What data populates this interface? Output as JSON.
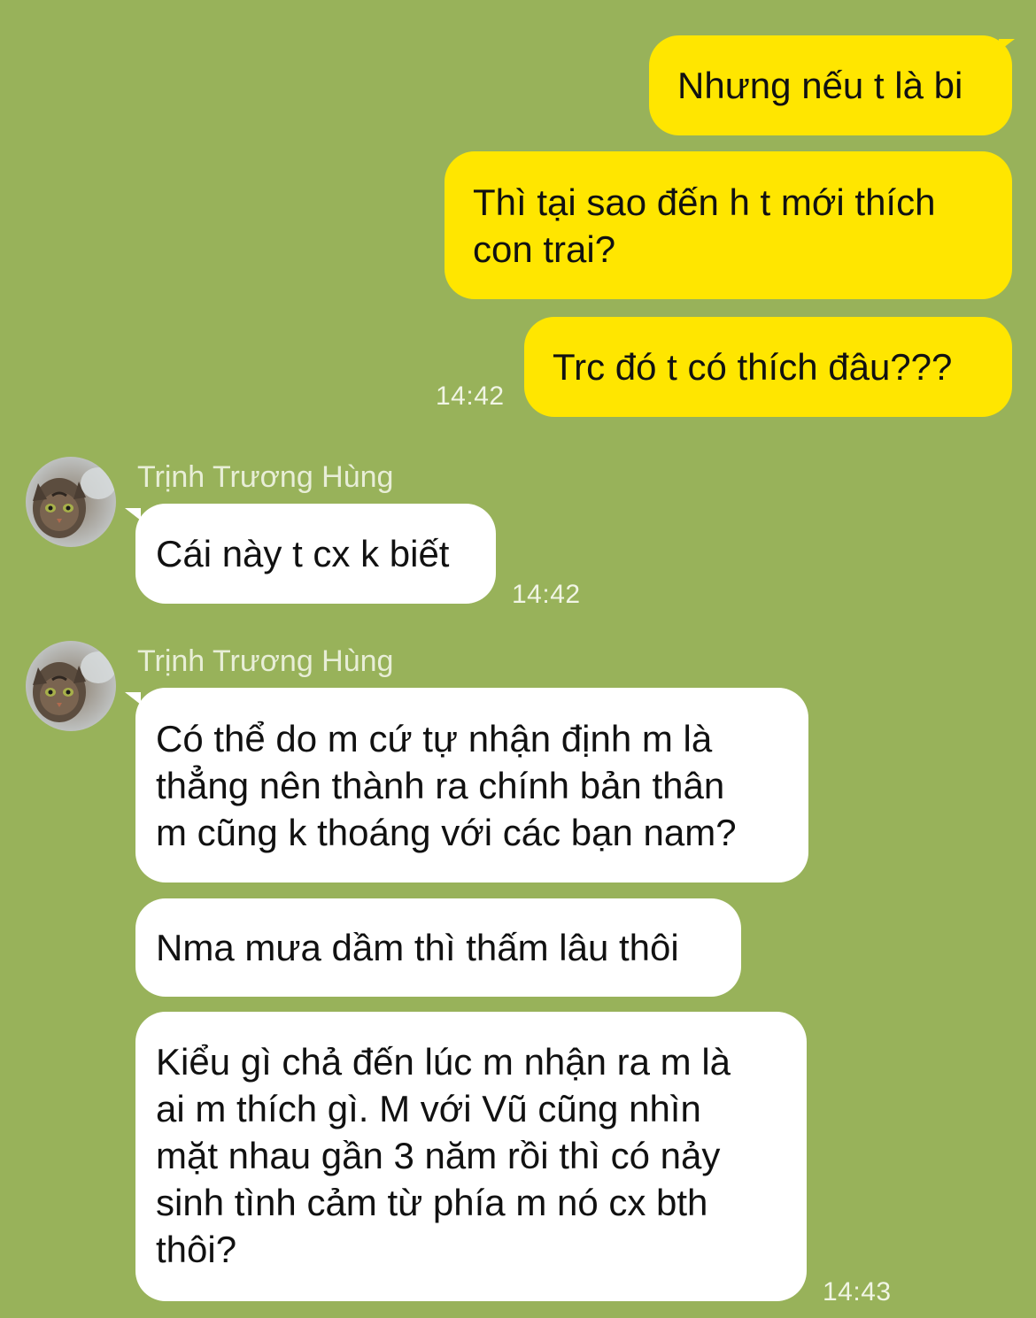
{
  "chat": {
    "outgoing": [
      {
        "text": "Nhưng nếu t là bi"
      },
      {
        "text": "Thì tại sao đến h t mới thích\ncon trai?"
      },
      {
        "text": "Trc đó t có thích đâu???"
      }
    ],
    "outgoing_time": "14:42",
    "incoming_groups": [
      {
        "sender_name": "Trịnh Trương Hùng",
        "avatar_icon": "cat-avatar-icon",
        "messages": [
          {
            "text": "Cái này t cx k biết"
          }
        ],
        "time": "14:42"
      },
      {
        "sender_name": "Trịnh Trương Hùng",
        "avatar_icon": "cat-avatar-icon",
        "messages": [
          {
            "text": "Có thể do m cứ tự nhận định m là\nthẳng nên thành ra chính bản thân\nm cũng k thoáng với các bạn nam?"
          },
          {
            "text": "Nma mưa dầm thì thấm lâu thôi"
          },
          {
            "text": "Kiểu gì chả đến lúc m nhận ra m là\nai m thích gì. M với Vũ cũng nhìn\nmặt nhau gần 3 năm rồi thì có nảy\nsinh tình cảm từ phía m nó cx bth\nthôi?"
          }
        ],
        "time": "14:43"
      }
    ],
    "colors": {
      "background": "#98b25a",
      "outgoing_bubble": "#ffe600",
      "incoming_bubble": "#ffffff"
    }
  }
}
